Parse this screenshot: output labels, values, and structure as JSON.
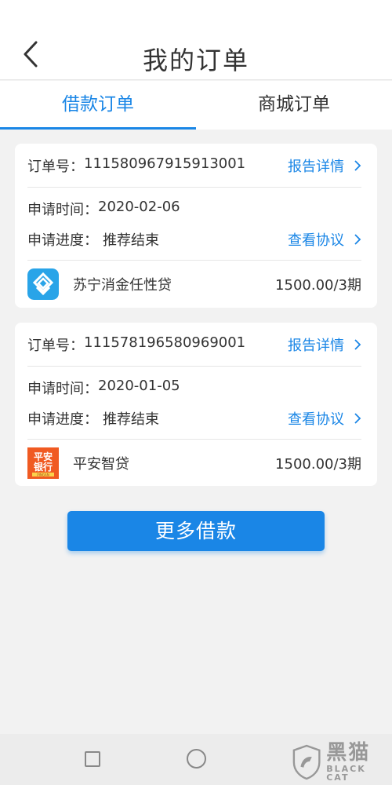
{
  "header": {
    "title": "我的订单"
  },
  "tabs": [
    {
      "label": "借款订单",
      "active": true
    },
    {
      "label": "商城订单",
      "active": false
    }
  ],
  "orders": [
    {
      "order_label": "订单号：",
      "order_no": "111580967915913001",
      "report_link": "报告详情",
      "apply_time_label": "申请时间：",
      "apply_time": "2020-02-06",
      "progress_label": "申请进度：",
      "progress": "推荐结束",
      "agreement_link": "查看协议",
      "product_name": "苏宁消金任性贷",
      "amount": "1500.00/3期",
      "logo_icon": "suning-consumer-finance-logo"
    },
    {
      "order_label": "订单号：",
      "order_no": "111578196580969001",
      "report_link": "报告详情",
      "apply_time_label": "申请时间：",
      "apply_time": "2020-01-05",
      "progress_label": "申请进度：",
      "progress": "推荐结束",
      "agreement_link": "查看协议",
      "product_name": "平安智贷",
      "amount": "1500.00/3期",
      "logo_icon": "pingan-bank-logo",
      "logo_text": [
        "平安",
        "银行",
        "PINGAN"
      ]
    }
  ],
  "more_button": {
    "label": "更多借款"
  },
  "watermark": {
    "cn": "黑猫",
    "en": "BLACK CAT"
  },
  "colors": {
    "accent": "#1a86e6",
    "status_dot": "#2bd19a",
    "pingan_orange": "#f05a22"
  }
}
